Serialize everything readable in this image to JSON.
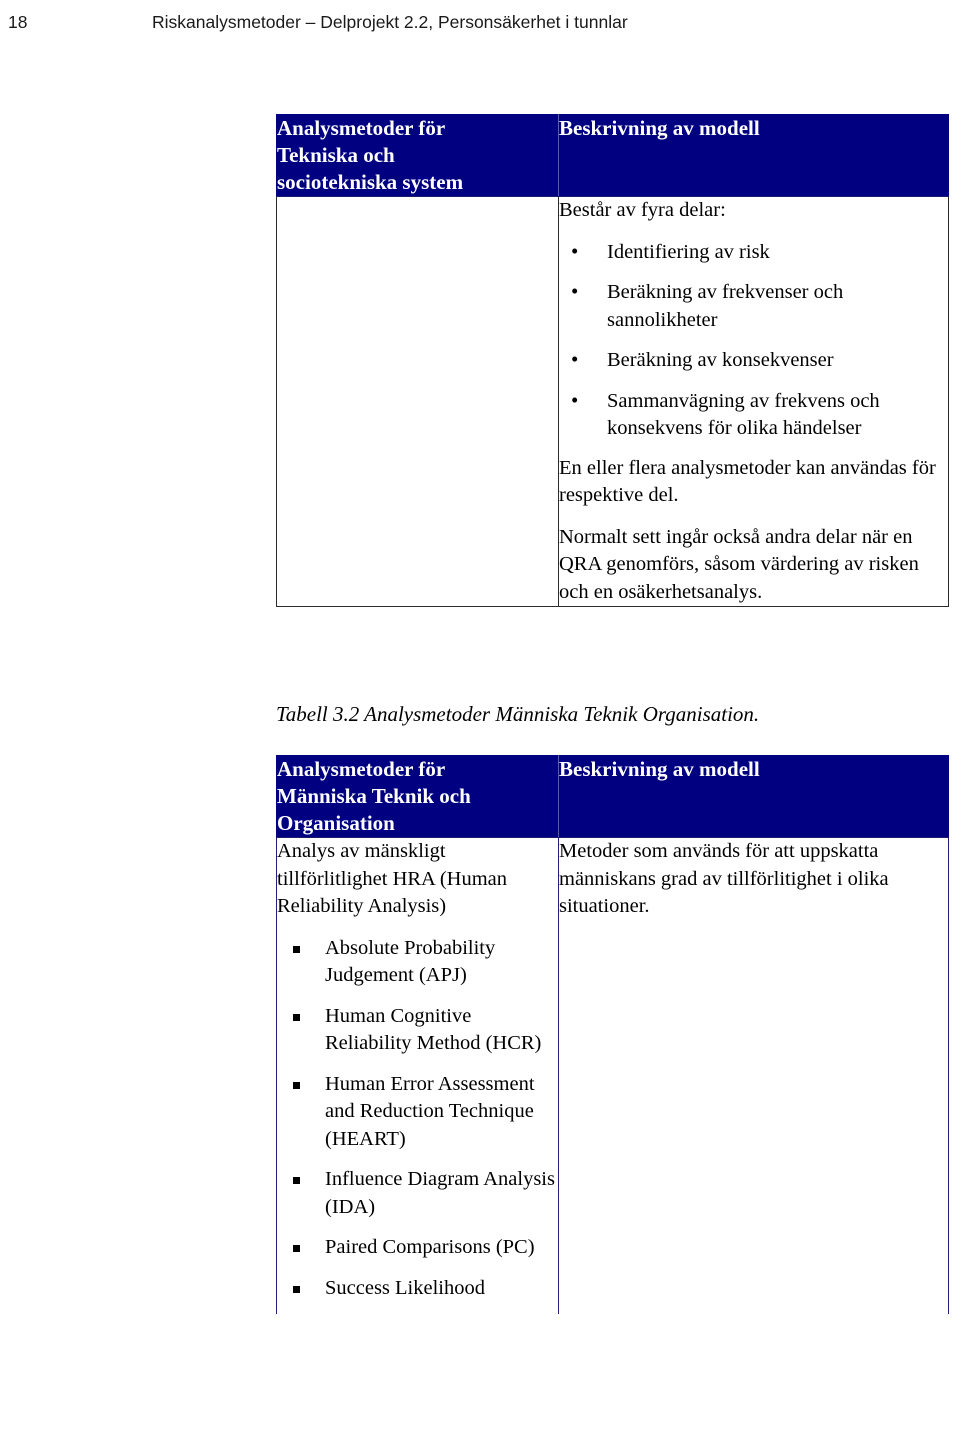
{
  "page": {
    "folio": "18",
    "running_title": "Riskanalysmetoder – Delprojekt 2.2, Personsäkerhet i tunnlar"
  },
  "colors": {
    "header_band": "#000080",
    "header_text": "#FFFFFF",
    "body_text": "#000000",
    "border": "#2B2B2B",
    "page_background": "#FFFFFF"
  },
  "table_1": {
    "headers": {
      "col1_line1": "Analysmetoder för",
      "col1_line2": "Tekniska och",
      "col1_line3": "sociotekniska system",
      "col2": "Beskrivning av modell"
    },
    "row": {
      "col1": "",
      "col2": {
        "intro": "Består av fyra delar:",
        "bullets": [
          "Identifiering av risk",
          "Beräkning av frekvenser och sannolikheter",
          "Beräkning av konsekvenser",
          "Sammanvägning av frekvens och konsekvens för olika händelser"
        ],
        "para1": "En eller flera analysmetoder kan användas för respektive del.",
        "para2": "Normalt sett ingår också andra delar när en QRA genomförs, såsom värdering av risken och en osäkerhetsanalys."
      }
    }
  },
  "caption": "Tabell 3.2 Analysmetoder Människa Teknik Organisation.",
  "table_2": {
    "headers": {
      "col1_line1": "Analysmetoder för",
      "col1_line2": "Människa Teknik och",
      "col1_line3": "Organisation",
      "col2": "Beskrivning av modell"
    },
    "row": {
      "col1": {
        "title": "Analys av mänskligt tillförlitlighet HRA (Human Reliability Analysis)",
        "bullets": [
          "Absolute Probability Judgement (APJ)",
          "Human Cognitive Reliability Method (HCR)",
          "Human Error Assessment and Reduction Technique (HEART)",
          "Influence Diagram Analysis (IDA)",
          "Paired Comparisons (PC)",
          "Success Likelihood"
        ]
      },
      "col2": {
        "para1": "Metoder som används för att uppskatta människans grad av tillförlitighet i olika situationer."
      }
    }
  }
}
